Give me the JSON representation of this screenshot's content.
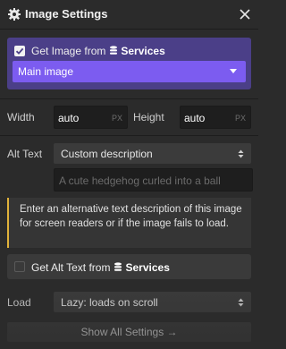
{
  "header": {
    "title": "Image Settings",
    "icon": "gear-icon",
    "close_icon": "close-icon"
  },
  "image_source": {
    "checked": true,
    "label": "Get Image from",
    "services_label": "Services",
    "selected": "Main image",
    "accent_color": "#7c5cf0",
    "box_color": "#4b3f88"
  },
  "dimensions": {
    "width_label": "Width",
    "width_value": "auto",
    "width_unit": "PX",
    "height_label": "Height",
    "height_value": "auto",
    "height_unit": "PX"
  },
  "alt_text": {
    "label": "Alt Text",
    "selected": "Custom description",
    "placeholder": "A cute hedgehog curled into a ball",
    "hint": "Enter an alternative text description of this image for screen readers or if the image fails to load.",
    "hint_accent_color": "#e0b23a"
  },
  "alt_source": {
    "checked": false,
    "label": "Get Alt Text from",
    "services_label": "Services"
  },
  "load": {
    "label": "Load",
    "selected": "Lazy: loads on scroll"
  },
  "footer": {
    "button_label": "Show All Settings →"
  }
}
